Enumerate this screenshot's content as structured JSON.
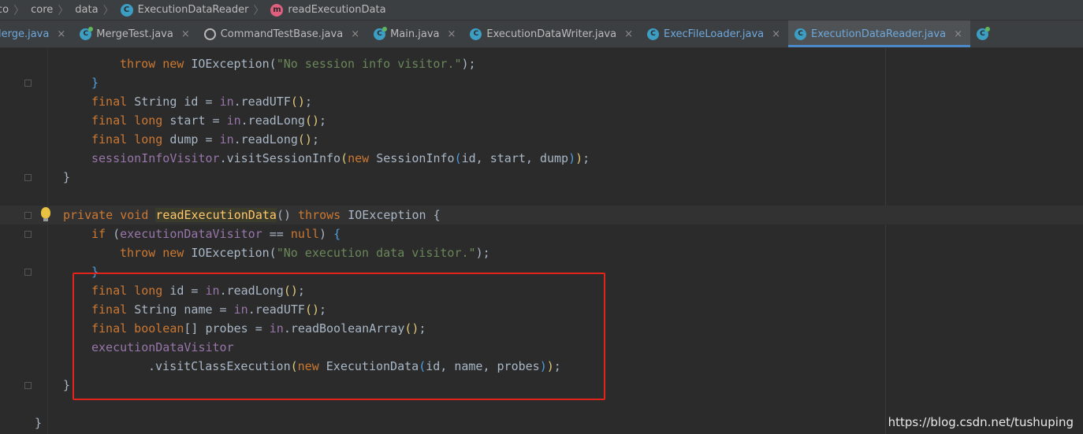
{
  "breadcrumb": [
    {
      "label": "co",
      "icon": null
    },
    {
      "label": "core",
      "icon": null
    },
    {
      "label": "data",
      "icon": null
    },
    {
      "label": "ExecutionDataReader",
      "icon": "class-icon"
    },
    {
      "label": "readExecutionData",
      "icon": "method-icon"
    }
  ],
  "tabs": [
    {
      "label": "lerge.java",
      "icon": "java-class",
      "active": false
    },
    {
      "label": "MergeTest.java",
      "icon": "test-class",
      "active": false
    },
    {
      "label": "CommandTestBase.java",
      "icon": "base-class",
      "active": false
    },
    {
      "label": "Main.java",
      "icon": "test-class",
      "active": false
    },
    {
      "label": "ExecutionDataWriter.java",
      "icon": "java-class",
      "active": false
    },
    {
      "label": "ExecFileLoader.java",
      "icon": "java-class",
      "active": false
    },
    {
      "label": "ExecutionDataReader.java",
      "icon": "java-class",
      "active": true
    }
  ],
  "tab_close_glyph": "×",
  "code_lines": [
    {
      "indent": 3,
      "segments": [
        [
          "kw",
          "throw "
        ],
        [
          "kw",
          "new "
        ],
        [
          "plain",
          "IOException("
        ],
        [
          "str",
          "\"No session info visitor.\""
        ],
        [
          "plain",
          ");"
        ]
      ]
    },
    {
      "indent": 2,
      "segments": [
        [
          "brace-b",
          "}"
        ]
      ]
    },
    {
      "indent": 2,
      "segments": [
        [
          "kw",
          "final "
        ],
        [
          "plain",
          "String id = "
        ],
        [
          "fld",
          "in"
        ],
        [
          "plain",
          "."
        ],
        [
          "plain",
          "readUTF"
        ],
        [
          "brace-y",
          "()"
        ],
        [
          "plain",
          ";"
        ]
      ]
    },
    {
      "indent": 2,
      "segments": [
        [
          "kw",
          "final long "
        ],
        [
          "plain",
          "start = "
        ],
        [
          "fld",
          "in"
        ],
        [
          "plain",
          ".readLong"
        ],
        [
          "brace-y",
          "()"
        ],
        [
          "plain",
          ";"
        ]
      ]
    },
    {
      "indent": 2,
      "segments": [
        [
          "kw",
          "final long "
        ],
        [
          "plain",
          "dump = "
        ],
        [
          "fld",
          "in"
        ],
        [
          "plain",
          ".readLong"
        ],
        [
          "brace-y",
          "()"
        ],
        [
          "plain",
          ";"
        ]
      ]
    },
    {
      "indent": 2,
      "segments": [
        [
          "fld",
          "sessionInfoVisitor"
        ],
        [
          "plain",
          ".visitSessionInfo"
        ],
        [
          "brace-y",
          "("
        ],
        [
          "kw",
          "new "
        ],
        [
          "plain",
          "SessionInfo"
        ],
        [
          "brace-b",
          "("
        ],
        [
          "plain",
          "id, start, dump"
        ],
        [
          "brace-b",
          ")"
        ],
        [
          "brace-y",
          ")"
        ],
        [
          "plain",
          ";"
        ]
      ]
    },
    {
      "indent": 1,
      "segments": [
        [
          "plain",
          "}"
        ]
      ]
    },
    {
      "indent": 0,
      "segments": []
    },
    {
      "indent": 1,
      "segments": [
        [
          "kw",
          "private void "
        ],
        [
          "mdecl",
          "readExecutionData"
        ],
        [
          "plain",
          "() "
        ],
        [
          "kw",
          "throws "
        ],
        [
          "plain",
          "IOException {"
        ]
      ]
    },
    {
      "indent": 2,
      "segments": [
        [
          "kw",
          "if "
        ],
        [
          "plain",
          "("
        ],
        [
          "fld",
          "executionDataVisitor"
        ],
        [
          "plain",
          " == "
        ],
        [
          "kw",
          "null"
        ],
        [
          "plain",
          ") "
        ],
        [
          "brace-b",
          "{"
        ]
      ]
    },
    {
      "indent": 3,
      "segments": [
        [
          "kw",
          "throw "
        ],
        [
          "kw",
          "new "
        ],
        [
          "plain",
          "IOException("
        ],
        [
          "str",
          "\"No execution data visitor.\""
        ],
        [
          "plain",
          ");"
        ]
      ]
    },
    {
      "indent": 2,
      "segments": [
        [
          "brace-b",
          "}"
        ]
      ]
    },
    {
      "indent": 2,
      "segments": [
        [
          "kw",
          "final long "
        ],
        [
          "plain",
          "id = "
        ],
        [
          "fld",
          "in"
        ],
        [
          "plain",
          ".readLong"
        ],
        [
          "brace-y",
          "()"
        ],
        [
          "plain",
          ";"
        ]
      ]
    },
    {
      "indent": 2,
      "segments": [
        [
          "kw",
          "final "
        ],
        [
          "plain",
          "String name = "
        ],
        [
          "fld",
          "in"
        ],
        [
          "plain",
          ".readUTF"
        ],
        [
          "brace-y",
          "()"
        ],
        [
          "plain",
          ";"
        ]
      ]
    },
    {
      "indent": 2,
      "segments": [
        [
          "kw",
          "final boolean"
        ],
        [
          "plain",
          "[] probes = "
        ],
        [
          "fld",
          "in"
        ],
        [
          "plain",
          ".readBooleanArray"
        ],
        [
          "brace-y",
          "()"
        ],
        [
          "plain",
          ";"
        ]
      ]
    },
    {
      "indent": 2,
      "segments": [
        [
          "fld",
          "executionDataVisitor"
        ]
      ]
    },
    {
      "indent": 4,
      "segments": [
        [
          "plain",
          ".visitClassExecution"
        ],
        [
          "brace-y",
          "("
        ],
        [
          "kw",
          "new "
        ],
        [
          "plain",
          "ExecutionData"
        ],
        [
          "brace-b",
          "("
        ],
        [
          "plain",
          "id, name, probes"
        ],
        [
          "brace-b",
          ")"
        ],
        [
          "brace-y",
          ")"
        ],
        [
          "plain",
          ";"
        ]
      ]
    },
    {
      "indent": 1,
      "segments": [
        [
          "plain",
          "}"
        ]
      ]
    },
    {
      "indent": 0,
      "segments": []
    },
    {
      "indent": 0,
      "segments": [
        [
          "plain",
          "}"
        ]
      ]
    }
  ],
  "watermark": "https://blog.csdn.net/tushuping"
}
